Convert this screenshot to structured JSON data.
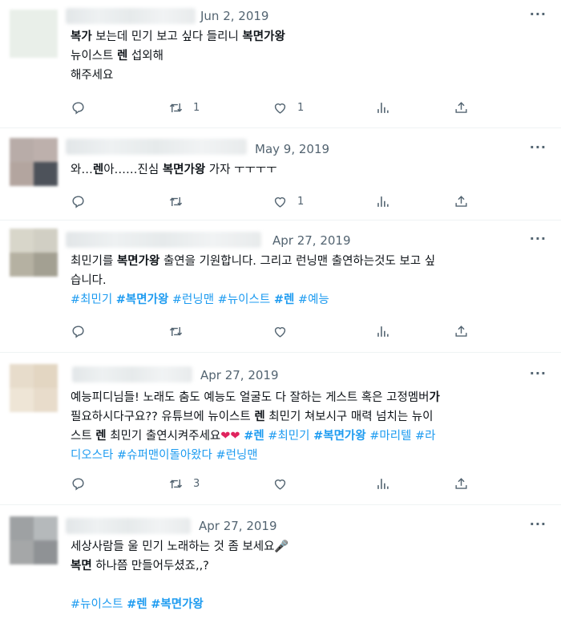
{
  "tweets": [
    {
      "date": "Jun 2, 2019",
      "lines": [
        [
          {
            "t": "복가",
            "b": true
          },
          {
            "t": " 보는데 민기 보고 싶다 들리니 "
          },
          {
            "t": "복면가왕",
            "b": true
          }
        ],
        [
          {
            "t": "뉴이스트 "
          },
          {
            "t": "렌",
            "b": true
          },
          {
            "t": " 섭외해"
          }
        ],
        [
          {
            "t": "해주세요"
          }
        ]
      ],
      "reply_count": "",
      "retweet_count": "1",
      "like_count": "1"
    },
    {
      "date": "May 9, 2019",
      "lines": [
        [
          {
            "t": "와…"
          },
          {
            "t": "렌",
            "b": true
          },
          {
            "t": "아……진심 "
          },
          {
            "t": "복면가왕",
            "b": true
          },
          {
            "t": " 가자 ㅜㅜㅜㅜ"
          }
        ]
      ],
      "reply_count": "",
      "retweet_count": "",
      "like_count": "1"
    },
    {
      "date": "Apr 27, 2019",
      "lines": [
        [
          {
            "t": "최민기를 "
          },
          {
            "t": "복면가왕",
            "b": true
          },
          {
            "t": " 출연을 기원합니다. 그리고 런닝맨 출연하는것도 보고 싶"
          }
        ],
        [
          {
            "t": "습니다."
          }
        ],
        [
          {
            "t": "#최민기 ",
            "tag": true
          },
          {
            "t": "#복면가왕",
            "tag": true,
            "b": true
          },
          {
            "t": " #런닝맨 #뉴이스트 ",
            "tag": true
          },
          {
            "t": "#렌",
            "tag": true,
            "b": true
          },
          {
            "t": " #예능",
            "tag": true
          }
        ]
      ],
      "reply_count": "",
      "retweet_count": "",
      "like_count": ""
    },
    {
      "date": "Apr 27, 2019",
      "lines": [
        [
          {
            "t": "예능피디님들! 노래도 춤도 예능도 얼굴도 다 잘하는 게스트 혹은 고정멤버"
          },
          {
            "t": "가",
            "b": true
          }
        ],
        [
          {
            "t": "필요하시다구요?? 유튜브에 뉴이스트 "
          },
          {
            "t": "렌",
            "b": true
          },
          {
            "t": " 최민기 쳐보시구 매력 넘치는 뉴이"
          }
        ],
        [
          {
            "t": "스트 "
          },
          {
            "t": "렌",
            "b": true
          },
          {
            "t": " 최민기 출연시켜주세요"
          },
          {
            "t": "❤❤",
            "heart": true
          },
          {
            "t": " "
          },
          {
            "t": "#렌",
            "tag": true,
            "b": true
          },
          {
            "t": " #최민기 ",
            "tag": true
          },
          {
            "t": "#복면가왕",
            "tag": true,
            "b": true
          },
          {
            "t": " #마리텔 #라",
            "tag": true
          }
        ],
        [
          {
            "t": "디오스타 #슈퍼맨이돌아왔다 #런닝맨",
            "tag": true
          }
        ]
      ],
      "reply_count": "",
      "retweet_count": "3",
      "like_count": ""
    },
    {
      "date": "Apr 27, 2019",
      "lines": [
        [
          {
            "t": "세상사람들 울 민기 노래하는 것 좀 보세요🎤"
          }
        ],
        [
          {
            "t": "복면",
            "b": true
          },
          {
            "t": " 하나쯤 만들어두셨죠,,?"
          }
        ],
        [
          {
            "t": ""
          }
        ],
        [
          {
            "t": "#뉴이스트 ",
            "tag": true
          },
          {
            "t": "#렌",
            "tag": true,
            "b": true
          },
          {
            "t": " ",
            "tag": true
          },
          {
            "t": "#복면가왕",
            "tag": true,
            "b": true
          }
        ]
      ],
      "reply_count": "",
      "retweet_count": "",
      "like_count": ""
    }
  ],
  "icons": {
    "reply": "reply-icon",
    "retweet": "retweet-icon",
    "like": "like-icon",
    "views": "views-icon",
    "share": "share-icon",
    "more": "more-icon"
  },
  "colors": {
    "text": "#0f1419",
    "muted": "#536471",
    "hashtag": "#1d9bf0",
    "divider": "#eff3f4"
  }
}
